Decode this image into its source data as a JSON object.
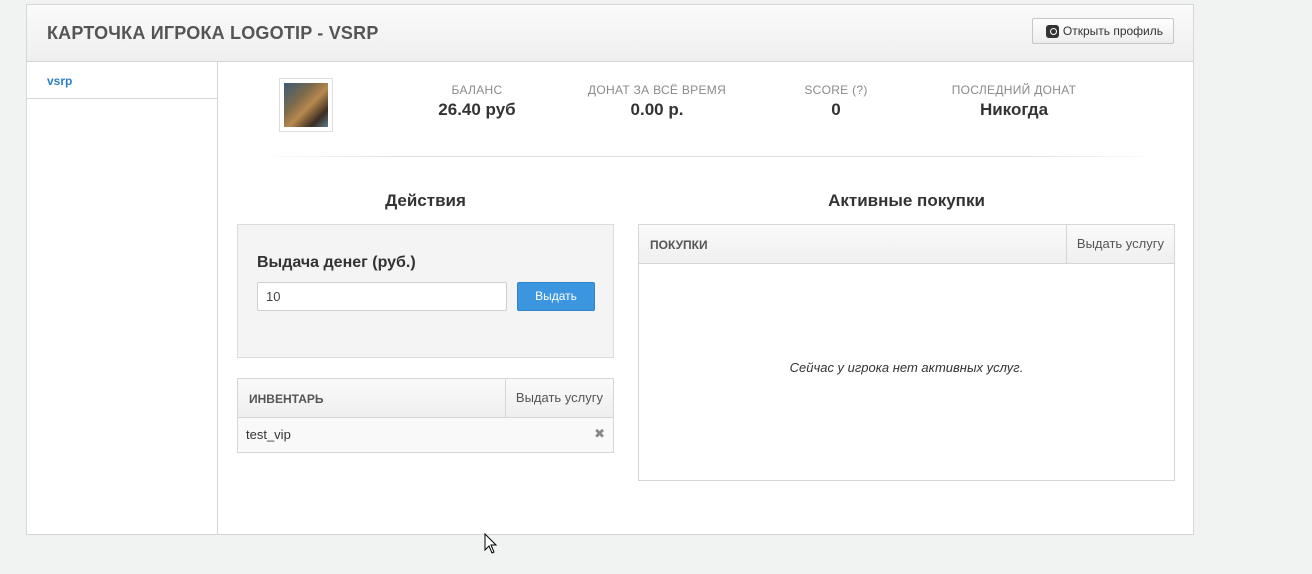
{
  "header": {
    "title": "КАРТОЧКА ИГРОКА LOGOTIP - VSRP",
    "open_profile_label": "Открыть профиль",
    "open_profile_icon": "steam-icon"
  },
  "sidebar": {
    "items": [
      {
        "label": "vsrp",
        "active": true
      }
    ]
  },
  "stats": [
    {
      "label": "БАЛАНС",
      "value": "26.40 руб"
    },
    {
      "label": "ДОНАТ ЗА ВСЁ ВРЕМЯ",
      "value": "0.00 р."
    },
    {
      "label": "SCORE (?)",
      "value": "0"
    },
    {
      "label": "ПОСЛЕДНИЙ ДОНАТ",
      "value": "Никогда"
    }
  ],
  "actions": {
    "title": "Действия",
    "money": {
      "title": "Выдача денег (руб.)",
      "input_value": "10",
      "button_label": "Выдать"
    }
  },
  "inventory": {
    "header": "ИНВЕНТАРЬ",
    "action_label": "Выдать услугу",
    "items": [
      {
        "name": "test_vip"
      }
    ]
  },
  "purchases": {
    "title": "Активные покупки",
    "header": "ПОКУПКИ",
    "action_label": "Выдать услугу",
    "empty_text": "Сейчас у игрока нет активных услуг."
  },
  "colors": {
    "accent": "#3c95df",
    "link": "#2a7fc4",
    "background": "#f1f2f2"
  }
}
